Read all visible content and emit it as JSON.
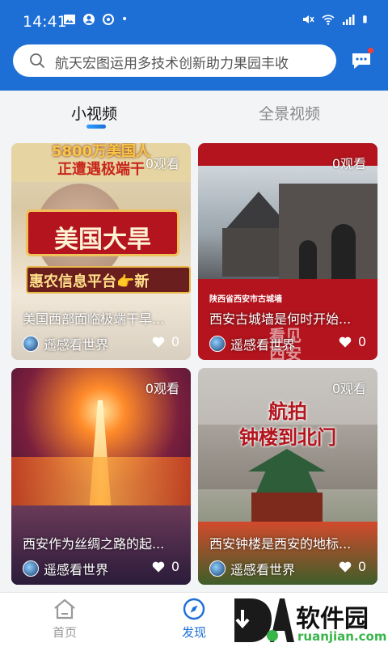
{
  "status_bar": {
    "time": "14:41",
    "dot": "•"
  },
  "search": {
    "placeholder": "航天宏图运用多技术创新助力果园丰收"
  },
  "tabs": [
    {
      "label": "小视频",
      "active": true
    },
    {
      "label": "全景视频",
      "active": false
    }
  ],
  "cards": [
    {
      "views": "0观看",
      "title": "美国西部面临极端干旱...",
      "author": "遥感看世界",
      "likes": "0",
      "overlay": [
        "5800万美国人",
        "正遭遇极端干",
        "美国大旱",
        "惠农信息平台👉新"
      ]
    },
    {
      "views": "0观看",
      "title": "西安古城墙是何时开始...",
      "author": "遥感看世界",
      "likes": "0",
      "overlay": [
        "陕西省西安市古城墙",
        "看见",
        "西安"
      ]
    },
    {
      "views": "0观看",
      "title": "西安作为丝绸之路的起...",
      "author": "遥感看世界",
      "likes": "0",
      "overlay": []
    },
    {
      "views": "0观看",
      "title": "西安钟楼是西安的地标...",
      "author": "遥感看世界",
      "likes": "0",
      "overlay": [
        "航拍",
        "钟楼到北门"
      ]
    }
  ],
  "bottom_nav": [
    {
      "label": "首页",
      "icon": "home-icon",
      "active": false
    },
    {
      "label": "发现",
      "icon": "compass-icon",
      "active": true
    }
  ],
  "watermark": {
    "brand": "软件园",
    "url": "ruanjian.com"
  },
  "colors": {
    "primary": "#1d6fd6",
    "inactive": "#9a9a9a",
    "red_banner": "#b3141d"
  }
}
